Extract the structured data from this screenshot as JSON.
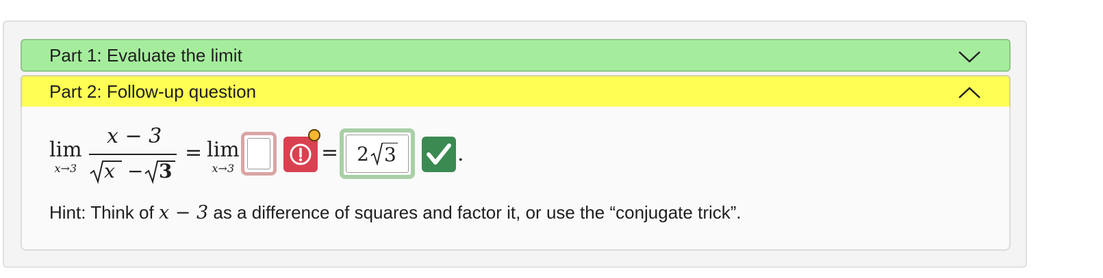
{
  "parts": [
    {
      "label": "Part 1: Evaluate the limit",
      "state": "collapsed",
      "color": "#a5ed9d"
    },
    {
      "label": "Part 2: Follow-up question",
      "state": "expanded",
      "color": "#fefe55"
    }
  ],
  "expression": {
    "lim_word": "lim",
    "lim_sub": "x→3",
    "frac_num": "x − 3",
    "frac_den_left": "x",
    "frac_den_minus": "−",
    "frac_den_right": "3",
    "equals": "=",
    "answer_blank_value": "",
    "answer_filled_value_coef": "2",
    "answer_filled_value_rad": "3",
    "period": "."
  },
  "status": {
    "error_color": "#d94150",
    "correct_color": "#3a8a52",
    "notification_color": "#f7b731"
  },
  "hint": {
    "prefix": "Hint: Think of ",
    "math": "x − 3",
    "suffix": " as a difference of squares and factor it, or use the “conjugate trick”."
  }
}
